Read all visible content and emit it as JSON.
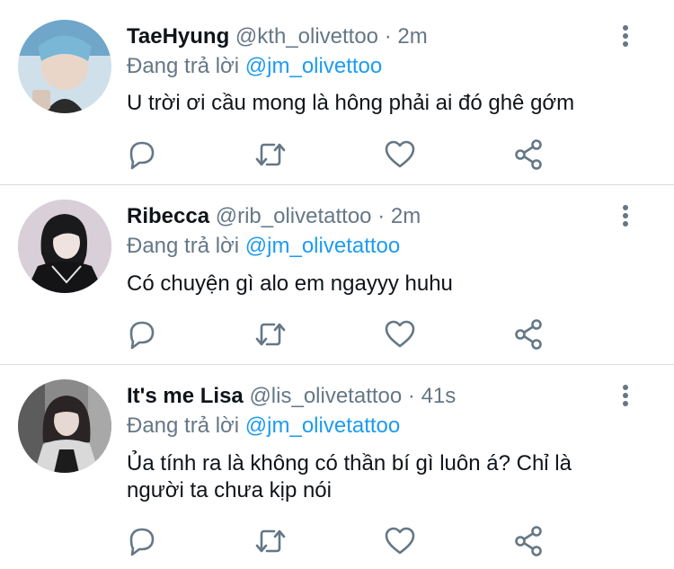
{
  "tweets": [
    {
      "name": "TaeHyung",
      "handle": "@kth_olivettoo",
      "dot": "·",
      "time": "2m",
      "reply_prefix": "Đang trả lời",
      "reply_to": "@jm_olivettoo",
      "text": "U trời ơi cầu mong là hông phải ai đó ghê gớm"
    },
    {
      "name": "Ribecca",
      "handle": "@rib_olivetattoo",
      "dot": "·",
      "time": "2m",
      "reply_prefix": "Đang trả lời",
      "reply_to": "@jm_olivetattoo",
      "text": "Có chuyện gì alo em ngayyy huhu"
    },
    {
      "name": "It's me Lisa",
      "handle": "@lis_olivetattoo",
      "dot": "·",
      "time": "41s",
      "reply_prefix": "Đang trả lời",
      "reply_to": "@jm_olivetattoo",
      "text": "Ủa tính ra là không có thần bí gì luôn á? Chỉ là người ta chưa kịp nói"
    }
  ],
  "icons": {
    "reply": "reply-icon",
    "retweet": "retweet-icon",
    "like": "heart-icon",
    "share": "share-icon",
    "more": "more-vertical-icon"
  },
  "colors": {
    "text": "#0f1419",
    "secondary": "#657786",
    "mention": "#1d9bf0",
    "divider": "#d9dde1"
  }
}
